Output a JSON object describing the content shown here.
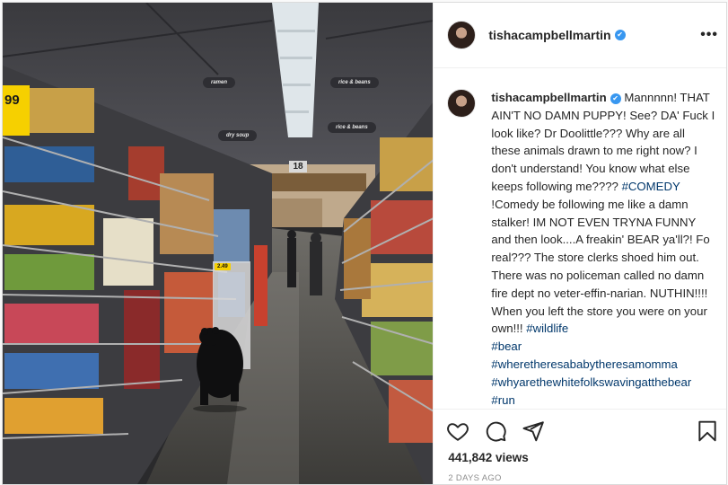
{
  "media": {
    "aisle_sign_left": "ramen",
    "aisle_sign_right": "rice & beans",
    "aisle_sign_left_low": "dry soup",
    "aisle_sign_right_low": "rice & beans",
    "aisle_number": "18",
    "price_tag": "99",
    "shelf_price": "2.49"
  },
  "header": {
    "username": "tishacampbellmartin",
    "verified_glyph": "✔",
    "more_label": "•••"
  },
  "caption": {
    "username": "tishacampbellmartin",
    "text": "Mannnnn! THAT AIN'T NO DAMN PUPPY! See? DA' Fuck I look like? Dr Doolittle??? Why are all these animals drawn to me right now? I don't understand! You know what else keeps following me???? ",
    "tag_comedy": "#COMEDY",
    "text2": " !Comedy be following me like a damn stalker! IM NOT EVEN TRYNA FUNNY and then look....A freakin' BEAR ya'll?! Fo real??? The store clerks shoed him out. There was no policeman called no damn fire dept no veter-effin-narian. NUTHIN!!!! When you left the store you were on your own!!! ",
    "tags": [
      "#wildlife",
      "#bear",
      "#wheretheresababytheresamomma",
      "#whyarethewhitefolkswavingatthebear",
      "#run"
    ]
  },
  "footer": {
    "views_count": "441,842",
    "views_label": " views",
    "timestamp": "2 DAYS AGO"
  },
  "icons": {
    "like": "heart-icon",
    "comment": "comment-icon",
    "share": "share-icon",
    "save": "bookmark-icon"
  },
  "colors": {
    "link": "#00376b",
    "verified": "#3897f0",
    "muted": "#8e8e8e"
  }
}
